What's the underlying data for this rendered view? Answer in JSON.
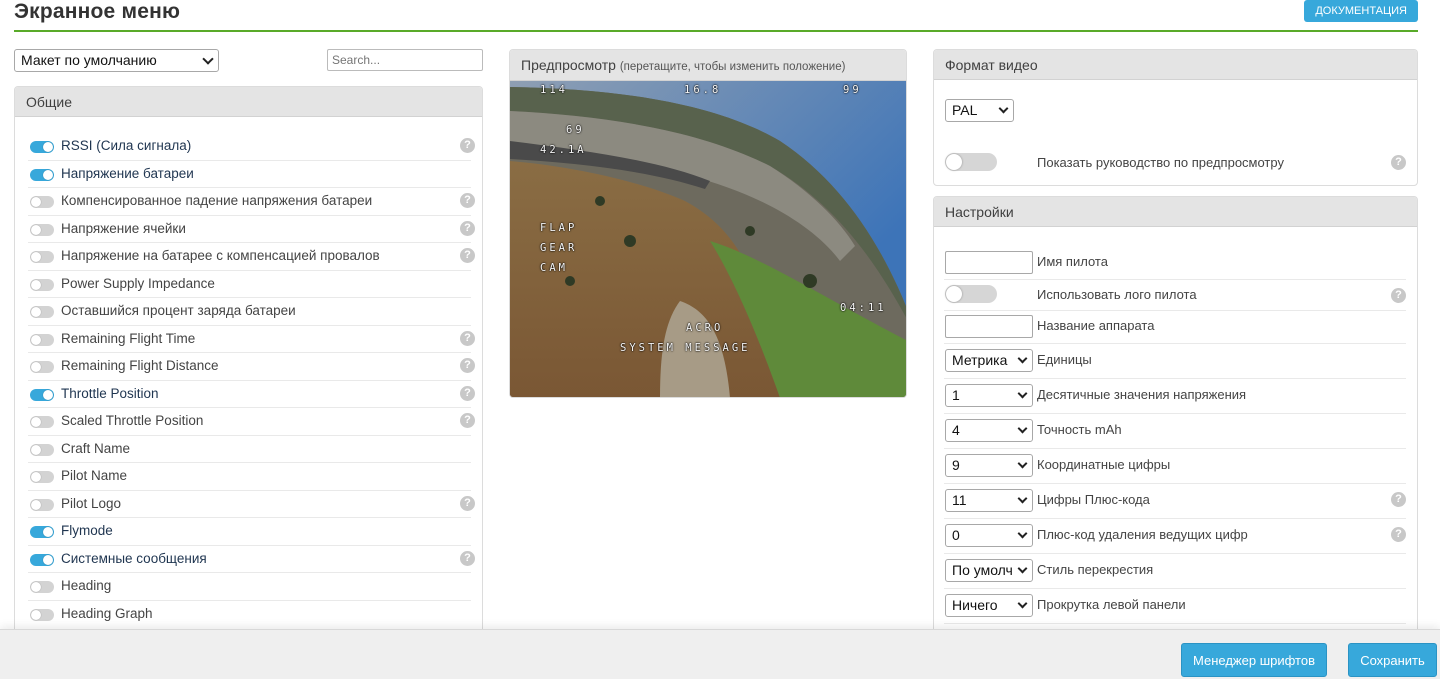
{
  "header": {
    "title": "Экранное меню",
    "documentation_label": "ДОКУМЕНТАЦИЯ"
  },
  "left": {
    "layout_select": {
      "value": "Макет по умолчанию"
    },
    "search": {
      "placeholder": "Search..."
    },
    "general_panel_title": "Общие",
    "elements": [
      {
        "label": "RSSI (Сила сигнала)",
        "enabled": true,
        "help": true
      },
      {
        "label": "Напряжение батареи",
        "enabled": true,
        "help": false
      },
      {
        "label": "Компенсированное падение напряжения батареи",
        "enabled": false,
        "help": true
      },
      {
        "label": "Напряжение ячейки",
        "enabled": false,
        "help": true
      },
      {
        "label": "Напряжение на батарее с компенсацией провалов",
        "enabled": false,
        "help": true
      },
      {
        "label": "Power Supply Impedance",
        "enabled": false,
        "help": false
      },
      {
        "label": "Оставшийся процент заряда батареи",
        "enabled": false,
        "help": false
      },
      {
        "label": "Remaining Flight Time",
        "enabled": false,
        "help": true
      },
      {
        "label": "Remaining Flight Distance",
        "enabled": false,
        "help": true
      },
      {
        "label": "Throttle Position",
        "enabled": true,
        "help": true
      },
      {
        "label": "Scaled Throttle Position",
        "enabled": false,
        "help": true
      },
      {
        "label": "Craft Name",
        "enabled": false,
        "help": false
      },
      {
        "label": "Pilot Name",
        "enabled": false,
        "help": false
      },
      {
        "label": "Pilot Logo",
        "enabled": false,
        "help": true
      },
      {
        "label": "Flymode",
        "enabled": true,
        "help": false
      },
      {
        "label": "Системные сообщения",
        "enabled": true,
        "help": true
      },
      {
        "label": "Heading",
        "enabled": false,
        "help": false
      },
      {
        "label": "Heading Graph",
        "enabled": false,
        "help": false
      }
    ]
  },
  "preview": {
    "title": "Предпросмотр",
    "subtitle": "(перетащите, чтобы изменить положение)",
    "osd": {
      "rssi": "114",
      "battery": "16.8",
      "satellites": "99",
      "speed": "69",
      "current": "42.1A",
      "flight_time": "04:11",
      "flap": "FLAP",
      "gear": "GEAR",
      "cam": "CAM",
      "mode": "ACRO",
      "system_message": "SYSTEM MESSAGE"
    }
  },
  "video_format": {
    "panel_title": "Формат видео",
    "format_value": "PAL",
    "show_guide_label": "Показать руководство по предпросмотру"
  },
  "settings": {
    "panel_title": "Настройки",
    "pilot_name_label": "Имя пилота",
    "pilot_logo_label": "Использовать лого пилота",
    "craft_name_label": "Название аппарата",
    "units_value": "Метрика",
    "units_label": "Единицы",
    "voltage_decimals_value": "1",
    "voltage_decimals_label": "Десятичные значения напряжения",
    "mah_precision_value": "4",
    "mah_precision_label": "Точность mAh",
    "coord_digits_value": "9",
    "coord_digits_label": "Координатные цифры",
    "plus_code_digits_value": "11",
    "plus_code_digits_label": "Цифры Плюс-кода",
    "plus_code_short_value": "0",
    "plus_code_short_label": "Плюс-код удаления ведущих цифр",
    "crosshair_value": "По умолч",
    "crosshair_label": "Стиль перекрестия",
    "left_scroll_value": "Ничего",
    "left_scroll_label": "Прокрутка левой панели"
  },
  "toolbar": {
    "font_manager_label": "Менеджер шрифтов",
    "save_label": "Сохранить"
  },
  "colors": {
    "accent": "#37a8db",
    "header_line": "#59aa29",
    "toggle_off": "#d3d3d3"
  }
}
